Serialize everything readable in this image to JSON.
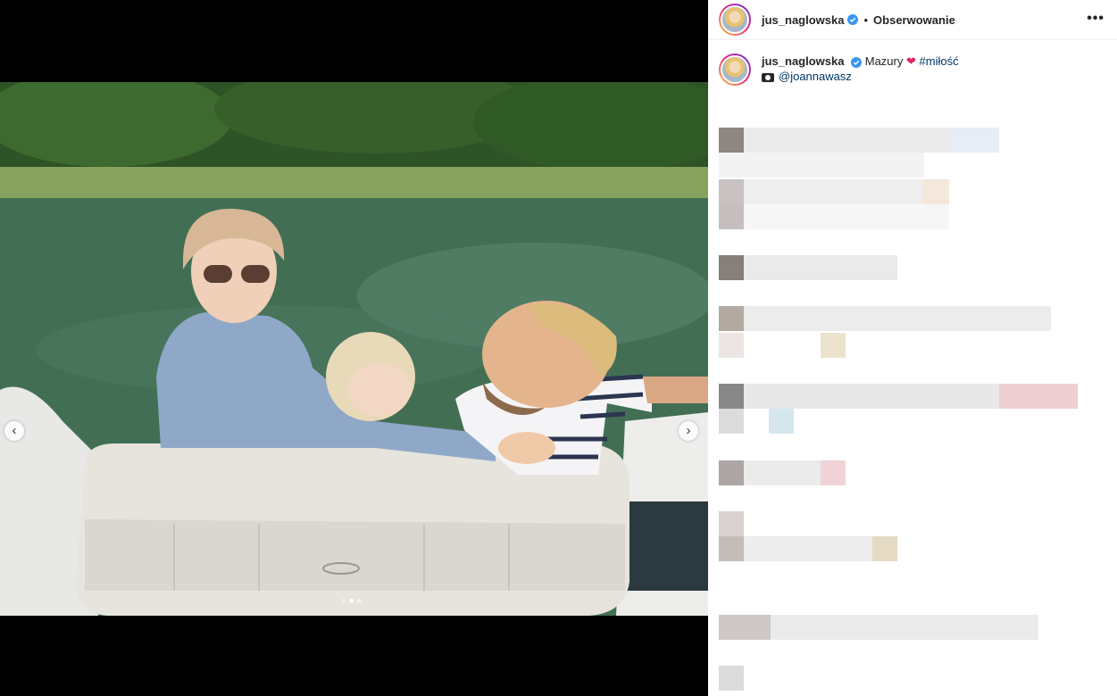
{
  "post": {
    "username": "jus_naglowska",
    "separator": "•",
    "follow_label": "Obserwowanie",
    "more_label": "•••",
    "caption": {
      "username": "jus_naglowska",
      "text": "Mazury",
      "heart": "❤",
      "hashtag": "#miłość",
      "photo_credit": "@joannawasz"
    },
    "carousel": {
      "prev_label": "‹",
      "next_label": "›",
      "slide_count": 3,
      "active_slide": 2
    }
  },
  "colors": {
    "verified": "#3897f0",
    "link": "#00376b",
    "text": "#262626"
  }
}
